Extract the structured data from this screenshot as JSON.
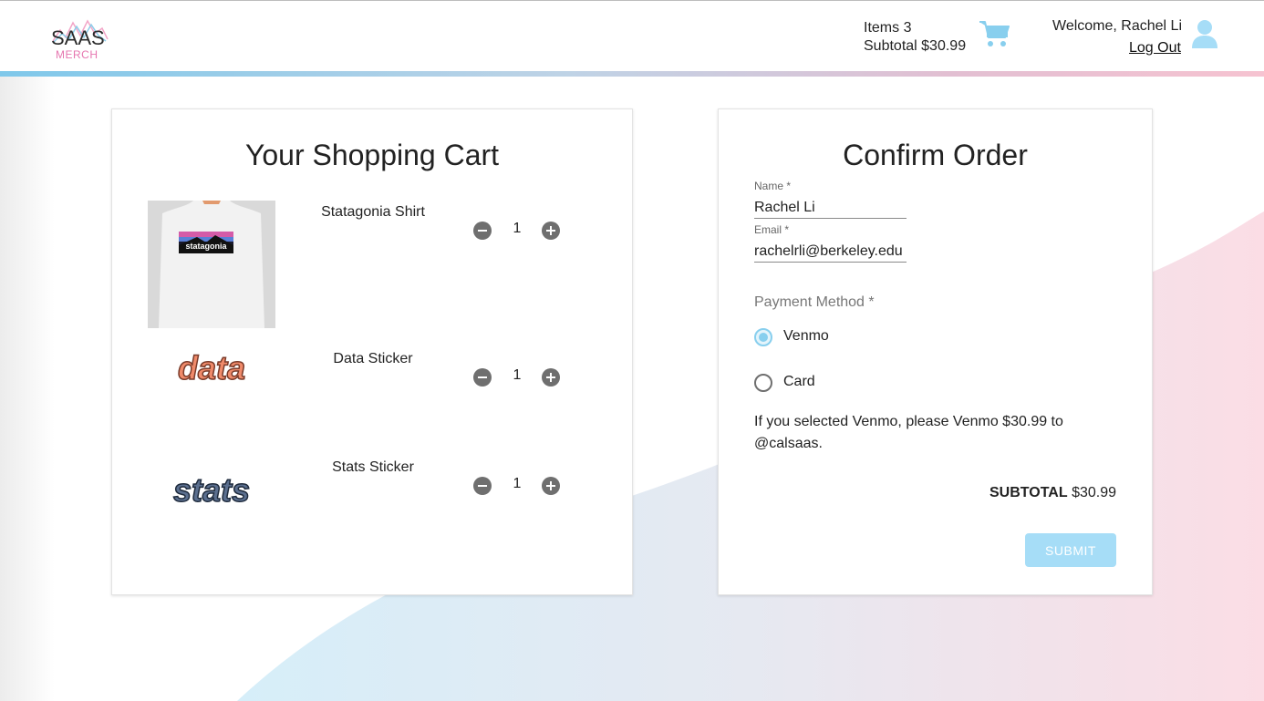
{
  "header": {
    "logo_main": "SAAS",
    "logo_sub": "MERCH",
    "items_text": "Items 3",
    "subtotal_text": "Subtotal $30.99",
    "welcome_text": "Welcome, Rachel Li",
    "logout_label": "Log Out"
  },
  "cart": {
    "title": "Your Shopping Cart",
    "items": [
      {
        "name": "Statagonia Shirt",
        "quantity": "1",
        "image_text": "statagonia"
      },
      {
        "name": "Data Sticker",
        "quantity": "1",
        "image_text": "data"
      },
      {
        "name": "Stats Sticker",
        "quantity": "1",
        "image_text": "stats"
      }
    ]
  },
  "order": {
    "title": "Confirm Order",
    "name_label": "Name *",
    "name_value": "Rachel Li",
    "email_label": "Email *",
    "email_value": "rachelrli@berkeley.edu",
    "payment_label": "Payment Method *",
    "options": [
      {
        "label": "Venmo",
        "selected": true
      },
      {
        "label": "Card",
        "selected": false
      }
    ],
    "venmo_note": "If you selected Venmo, please Venmo $30.99 to @calsaas.",
    "subtotal_label": "SUBTOTAL",
    "subtotal_value": "$30.99",
    "submit_label": "SUBMIT"
  },
  "colors": {
    "accent": "#88cfee",
    "submit": "#a6ddf7",
    "logo_pink": "#e676b0"
  }
}
